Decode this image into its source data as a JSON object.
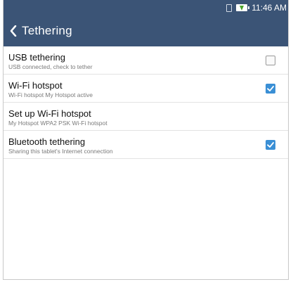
{
  "status_bar": {
    "time": "11:46 AM",
    "icons": [
      "sim-icon",
      "battery-charging-icon"
    ],
    "background": "#3b5476"
  },
  "action_bar": {
    "title": "Tethering",
    "back_icon": "chevron-left-icon"
  },
  "settings": [
    {
      "label": "USB tethering",
      "summary": "USB connected, check to tether",
      "has_checkbox": true,
      "checked": false
    },
    {
      "label": "Wi-Fi hotspot",
      "summary": "Wi-Fi hotspot My Hotspot active",
      "has_checkbox": true,
      "checked": true
    },
    {
      "label": "Set up Wi-Fi hotspot",
      "summary": "My Hotspot WPA2 PSK Wi-Fi hotspot",
      "has_checkbox": false
    },
    {
      "label": "Bluetooth tethering",
      "summary": "Sharing this tablet's Internet connection",
      "has_checkbox": true,
      "checked": true
    }
  ],
  "colors": {
    "accent": "#3a8fd5",
    "header": "#3b5476"
  }
}
